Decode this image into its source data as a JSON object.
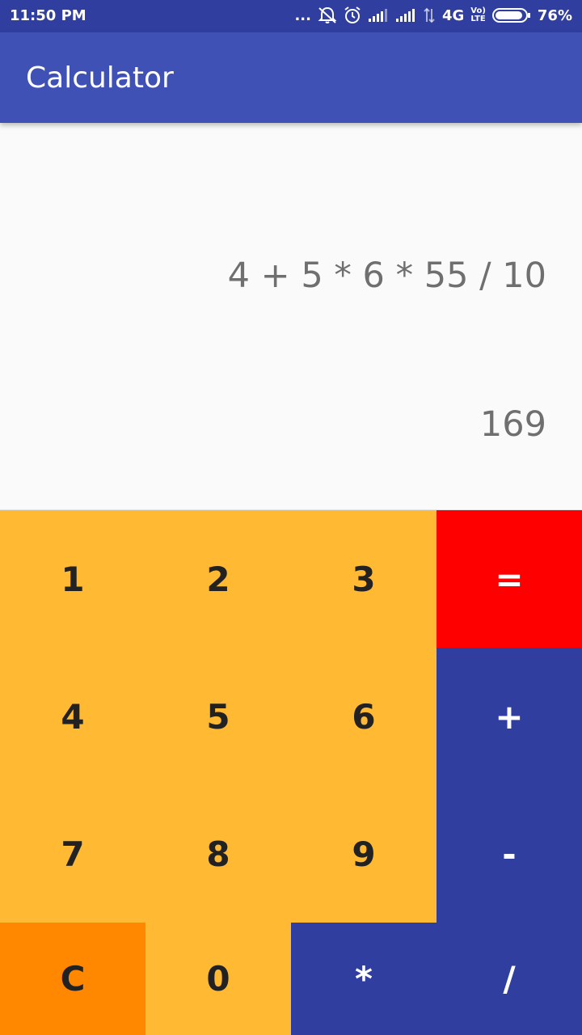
{
  "status_bar": {
    "time": "11:50 PM",
    "more": "...",
    "network": "4G",
    "volte_top": "Vo)",
    "volte_bottom": "LTE",
    "battery": "76%",
    "icons": [
      "more-dots-icon",
      "alarm-muted-icon",
      "alarm-clock-icon",
      "signal-icon",
      "signal-icon",
      "data-arrows-icon",
      "volte-icon",
      "battery-icon"
    ]
  },
  "app_bar": {
    "title": "Calculator"
  },
  "display": {
    "expression": "4 + 5 * 6 * 55 / 10",
    "result": "169"
  },
  "keypad": {
    "k1": "1",
    "k2": "2",
    "k3": "3",
    "eq": "=",
    "k4": "4",
    "k5": "5",
    "k6": "6",
    "plus": "+",
    "k7": "7",
    "k8": "8",
    "k9": "9",
    "minus": "-",
    "clear": "C",
    "k0": "0",
    "mul": "*",
    "div": "/"
  },
  "colors": {
    "status_bar": "#303f9f",
    "app_bar": "#3f51b5",
    "digit_keys": "#ffb933",
    "clear_key": "#ff8800",
    "equals_key": "#ff0000",
    "operator_keys": "#303f9f",
    "display_text": "#6f6f6f"
  }
}
